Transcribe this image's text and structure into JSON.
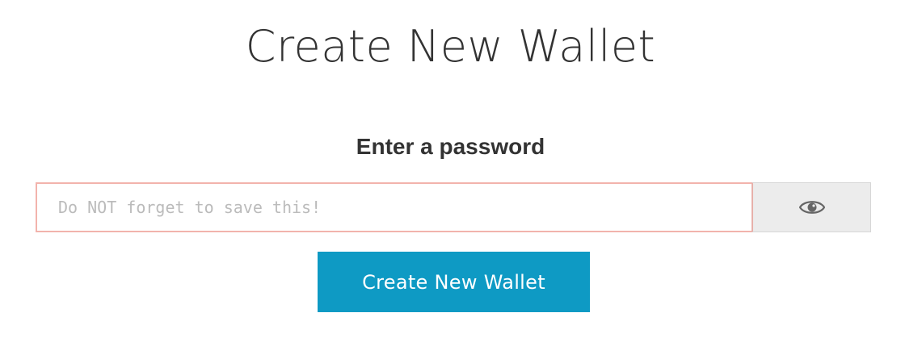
{
  "page": {
    "title": "Create New Wallet",
    "subtitle": "Enter a password"
  },
  "password_field": {
    "placeholder": "Do NOT forget to save this!",
    "value": "",
    "toggle_icon": "eye-icon"
  },
  "actions": {
    "create_label": "Create New Wallet"
  },
  "colors": {
    "accent": "#0e9ac4",
    "input_border": "#f2b3ac",
    "toggle_bg": "#ececec"
  }
}
